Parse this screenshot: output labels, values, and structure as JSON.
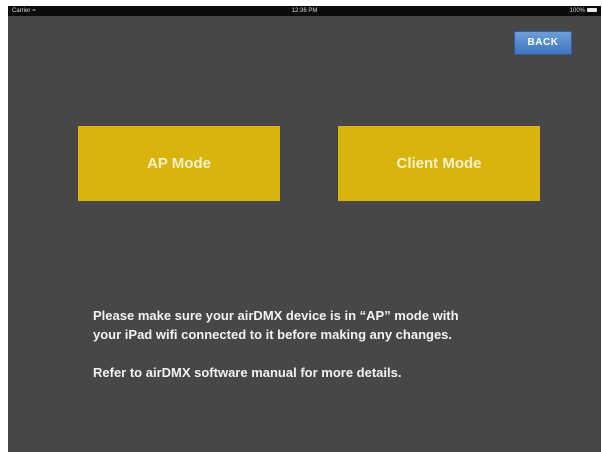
{
  "status_bar": {
    "carrier": "Carrier",
    "time": "12:36 PM",
    "battery": "100%"
  },
  "header": {
    "back_label": "BACK"
  },
  "modes": [
    {
      "label": "AP Mode"
    },
    {
      "label": "Client Mode"
    }
  ],
  "info": {
    "line1": "Please make sure your airDMX device is in “AP” mode with",
    "line2": "your iPad wifi connected to it before making any changes.",
    "line3": "Refer to airDMX software manual for more details."
  },
  "colors": {
    "background": "#474747",
    "mode_button": "#d9b40c",
    "back_button": "#4a80c8"
  },
  "icons": [
    "wifi-icon",
    "battery-icon"
  ]
}
